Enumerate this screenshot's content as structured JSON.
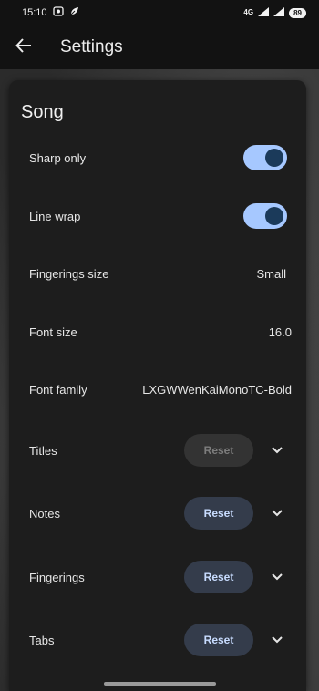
{
  "status_bar": {
    "time": "15:10",
    "icons": [
      "screenshot-icon",
      "leaf-icon"
    ],
    "network": "4G",
    "battery": "89"
  },
  "app_bar": {
    "title": "Settings",
    "back_icon": "arrow-left-icon"
  },
  "section": {
    "title": "Song"
  },
  "settings": [
    {
      "label": "Sharp only",
      "type": "toggle",
      "on": true
    },
    {
      "label": "Line wrap",
      "type": "toggle",
      "on": true
    },
    {
      "label": "Fingerings size",
      "type": "value",
      "value": "Small"
    },
    {
      "label": "Font size",
      "type": "value",
      "value": "16.0"
    },
    {
      "label": "Font family",
      "type": "value",
      "value": "LXGWWenKaiMonoTC-Bold"
    },
    {
      "label": "Titles",
      "type": "reset",
      "reset_label": "Reset",
      "enabled": false
    },
    {
      "label": "Notes",
      "type": "reset",
      "reset_label": "Reset",
      "enabled": true
    },
    {
      "label": "Fingerings",
      "type": "reset",
      "reset_label": "Reset",
      "enabled": true
    },
    {
      "label": "Tabs",
      "type": "reset",
      "reset_label": "Reset",
      "enabled": true
    }
  ],
  "colors": {
    "toggle_track": "#a6c8ff",
    "toggle_knob": "#1b3a5a",
    "reset_enabled_bg": "#343c4b",
    "reset_enabled_text": "#c8dcff",
    "reset_disabled_bg": "#333333",
    "reset_disabled_text": "#7d7d7d",
    "panel": "#1d1d1d"
  }
}
